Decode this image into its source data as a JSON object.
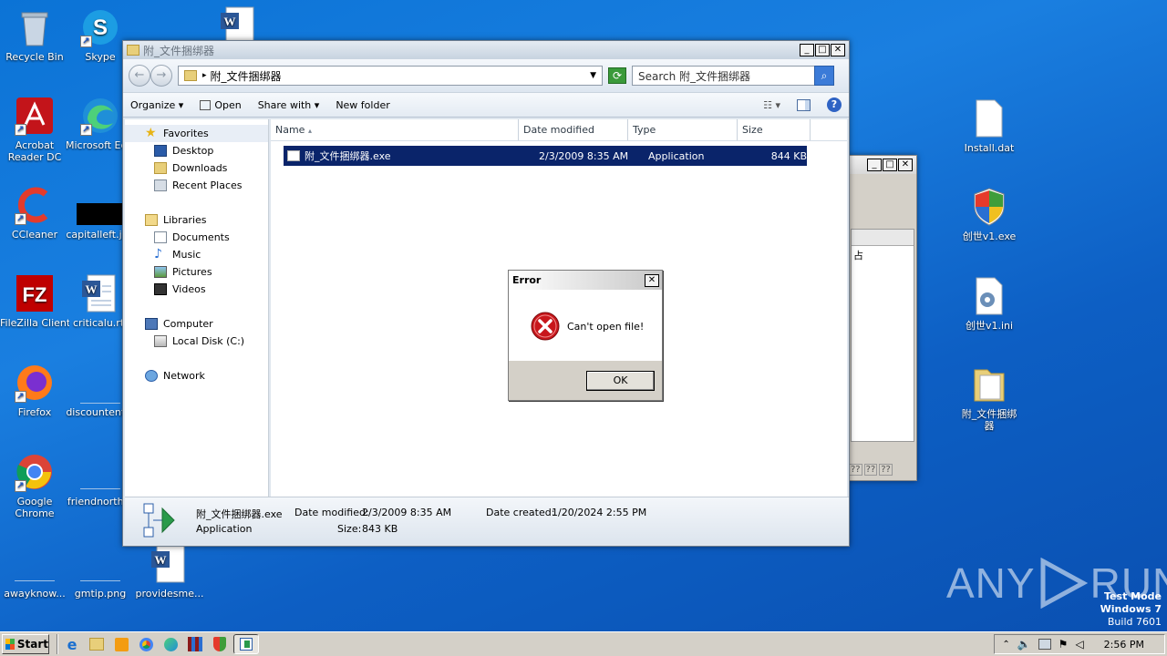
{
  "desktop": {
    "icons": [
      {
        "label": "Recycle Bin",
        "icon": "recycle-bin-icon"
      },
      {
        "label": "Skype",
        "icon": "skype-icon"
      },
      {
        "label": "Acrobat\nReader DC",
        "icon": "acrobat-icon"
      },
      {
        "label": "Microsoft Edge",
        "icon": "edge-icon"
      },
      {
        "label": "CCleaner",
        "icon": "ccleaner-icon"
      },
      {
        "label": "capitalleft.jpg",
        "icon": "image-file-icon"
      },
      {
        "label": "FileZilla Client",
        "icon": "filezilla-icon"
      },
      {
        "label": "criticalu.rtf",
        "icon": "word-doc-icon"
      },
      {
        "label": "Firefox",
        "icon": "firefox-icon"
      },
      {
        "label": "discountent...",
        "icon": "blank-file-icon"
      },
      {
        "label": "Google\nChrome",
        "icon": "chrome-icon"
      },
      {
        "label": "friendnorth...",
        "icon": "blank-file-icon"
      },
      {
        "label": "awayknow...",
        "icon": "blank-file-icon"
      },
      {
        "label": "gmtip.png",
        "icon": "blank-file-icon"
      },
      {
        "label": "providesme...",
        "icon": "word-doc-icon"
      },
      {
        "label": "Install.dat",
        "icon": "blank-file-icon"
      },
      {
        "label": "创世v1.exe",
        "icon": "shield-exe-icon"
      },
      {
        "label": "创世v1.ini",
        "icon": "settings-file-icon"
      },
      {
        "label": "附_文件捆绑\n器",
        "icon": "folder-icon"
      }
    ]
  },
  "explorer": {
    "title": "附_文件捆绑器",
    "address": "附_文件捆绑器",
    "search_placeholder": "Search 附_文件捆绑器",
    "toolbar": {
      "organize": "Organize",
      "open": "Open",
      "share_with": "Share with",
      "new_folder": "New folder"
    },
    "nav": {
      "favorites": "Favorites",
      "desktop": "Desktop",
      "downloads": "Downloads",
      "recent_places": "Recent Places",
      "libraries": "Libraries",
      "documents": "Documents",
      "music": "Music",
      "pictures": "Pictures",
      "videos": "Videos",
      "computer": "Computer",
      "local_disk": "Local Disk (C:)",
      "network": "Network"
    },
    "columns": {
      "name": "Name",
      "date_modified": "Date modified",
      "type": "Type",
      "size": "Size"
    },
    "files": [
      {
        "name": "附_文件捆绑器.exe",
        "date_modified": "2/3/2009 8:35 AM",
        "type": "Application",
        "size": "844 KB"
      }
    ],
    "details": {
      "filename": "附_文件捆绑器.exe",
      "type": "Application",
      "date_modified_label": "Date modified:",
      "date_modified": "2/3/2009 8:35 AM",
      "date_created_label": "Date created:",
      "date_created": "1/20/2024 2:55 PM",
      "size_label": "Size:",
      "size": "843 KB"
    }
  },
  "bgwindow": {
    "glyph": "占",
    "scroll": "??"
  },
  "dialog": {
    "title": "Error",
    "message": "Can't open file!",
    "ok": "OK"
  },
  "watermark": {
    "brand": "ANY",
    "brand2": "RUN",
    "line1": "Test Mode",
    "line2": "Windows 7",
    "line3": "Build 7601"
  },
  "taskbar": {
    "start": "Start",
    "time": "2:56 PM"
  }
}
